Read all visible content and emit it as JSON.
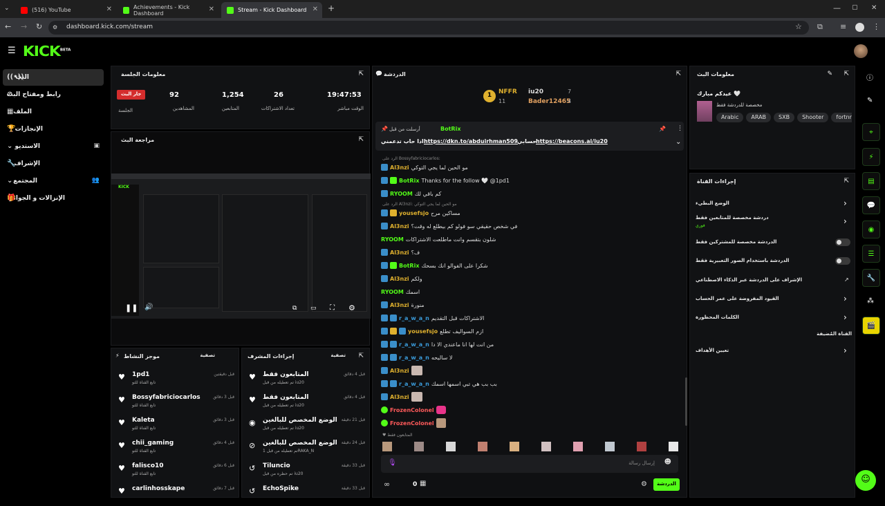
{
  "browser": {
    "tabs": [
      {
        "title": "(516) YouTube",
        "fav": "#ff0000"
      },
      {
        "title": "Achievements - Kick Dashboard",
        "fav": "#53fc18"
      },
      {
        "title": "Stream - Kick Dashboard",
        "fav": "#53fc18"
      }
    ],
    "url": "dashboard.kick.com/stream"
  },
  "brand": {
    "logo": "KICK",
    "beta": "BETA",
    "accent": "#53fc18"
  },
  "sidebar": {
    "items": [
      {
        "label": "البث",
        "icon": "broadcast-icon"
      },
      {
        "label": "رابط ومفتاح البث",
        "icon": "link-icon"
      },
      {
        "label": "الملف",
        "icon": "profile-icon"
      },
      {
        "label": "الإنجازات",
        "icon": "trophy-icon"
      },
      {
        "label": "الاستديو",
        "icon": "studio-icon"
      },
      {
        "label": "الإشراف",
        "icon": "wrench-icon"
      },
      {
        "label": "المجتمع",
        "icon": "community-icon"
      },
      {
        "label": "الإنزالات و الجوائز",
        "icon": "gift-icon"
      }
    ]
  },
  "session": {
    "title": "معلومات الجلسة",
    "live_badge": "جار البث",
    "session_label": "الجلسة",
    "stats": [
      {
        "value": "92",
        "label": "المشاهدين"
      },
      {
        "value": "1,254",
        "label": "المتابعين"
      },
      {
        "value": "26",
        "label": "تعداد الاشتراكات"
      },
      {
        "value": "19:47:53",
        "label": "الوقت مباشر"
      }
    ]
  },
  "preview": {
    "title": "مراجعة البث"
  },
  "activity": {
    "title": "موجز النشاط",
    "filter": "تصفية",
    "items": [
      {
        "name": "1pd1",
        "sub": "تابع القناة للتو",
        "time": "قبل دقيقتين"
      },
      {
        "name": "Bossyfabriciocarlos",
        "sub": "تابع القناة للتو",
        "time": "قبل 3 دقائق"
      },
      {
        "name": "Kaleta",
        "sub": "تابع القناة للتو",
        "time": "قبل 3 دقائق"
      },
      {
        "name": "chii_gaming",
        "sub": "تابع القناة للتو",
        "time": "قبل 4 دقائق"
      },
      {
        "name": "falisco10",
        "sub": "تابع القناة للتو",
        "time": "قبل 6 دقائق"
      },
      {
        "name": "carlinhosskape",
        "sub": "",
        "time": "قبل 7 دقائق"
      }
    ]
  },
  "modactions": {
    "title": "إجراءات المشرف",
    "filter": "تصفية",
    "items": [
      {
        "name": "المتابعون فقط",
        "sub": "تم تعطيله من قبل iu20",
        "time": "قبل 4 دقائق",
        "icon": "heart-icon"
      },
      {
        "name": "المتابعون فقط",
        "sub": "تم تعطيله من قبل iu20",
        "time": "قبل 4 دقائق",
        "icon": "heart-icon"
      },
      {
        "name": "الوضع المخصص للبالغين",
        "sub": "تم تعطيله من قبل iu20",
        "time": "قبل 21 دقيقة",
        "icon": "eye-icon"
      },
      {
        "name": "الوضع المخصص للبالغين",
        "sub": "تم تعطيله من قبل 1RAKA_N",
        "time": "قبل 24 دقيقة",
        "icon": "eye-off-icon"
      },
      {
        "name": "Tiluncio",
        "sub": "تم حظره من قبل iu20",
        "time": "قبل 33 دقيقة",
        "icon": "undo-icon"
      },
      {
        "name": "EchoSpike",
        "sub": "",
        "time": "قبل 33 دقيقة",
        "icon": "undo-icon"
      }
    ]
  },
  "chat": {
    "title": "الدردشة",
    "top": {
      "user1": "NFFR",
      "n1": "11",
      "user2": "iu20",
      "n2": "7",
      "user3": "Bader12465",
      "n3": "4"
    },
    "pinned": {
      "label": "أرسلت من قبل",
      "user": "BotRix",
      "text_a": "https://dkn.to/abduirhman509",
      "text_b": "حسابي",
      "text_c": "https://beacons.ai/iu20",
      "text_d": "اذا حاب تدعمني"
    },
    "messages": [
      {
        "reply": "الرد على Bossyfabriciocarlos:"
      },
      {
        "user": "Al3nzi",
        "color": "#e0b12e",
        "text": "مو الحين لما يجي التوكي"
      },
      {
        "user": "BotRix",
        "color": "#53fc18",
        "text": "Thanks for the follow 🤍 @1pd1"
      },
      {
        "user": "RYOOM",
        "color": "#53fc18",
        "text": "كم باقي لك"
      },
      {
        "reply": "الرد على Al3nzi: مو الحين لما يجي التوكي"
      },
      {
        "user": "yousefsjo",
        "color": "#e0b12e",
        "text": "مساكين مرح"
      },
      {
        "user": "Al3nzi",
        "color": "#e0b12e",
        "text": "في شخص حقيقي سو فولو كم بيطلع له وقت؟"
      },
      {
        "user": "RYOOM",
        "color": "#53fc18",
        "text": "شلون بتقسم وانت ماطلعت الاشتراكات"
      },
      {
        "user": "Al3nzi",
        "color": "#e0b12e",
        "text": "ف؟"
      },
      {
        "user": "BotRix",
        "color": "#53fc18",
        "text": "شكرا على الفوالو انك بسحك"
      },
      {
        "user": "Al3nzi",
        "color": "#e0b12e",
        "text": "ولكم"
      },
      {
        "user": "RYOOM",
        "color": "#53fc18",
        "text": "اسمك"
      },
      {
        "user": "Al3nzi",
        "color": "#e0b12e",
        "text": "منورة"
      },
      {
        "user": "r_a_w_a_n",
        "color": "#3a9ad9",
        "text": "الاشتراكات قبل التقديم"
      },
      {
        "user": "yousefsjo",
        "color": "#e0b12e",
        "text": "ازم السواليف تطلع"
      },
      {
        "user": "r_a_w_a_n",
        "color": "#3a9ad9",
        "text": "من انت لها انا ماعندي الا دا"
      },
      {
        "user": "r_a_w_a_n",
        "color": "#3a9ad9",
        "text": "لا ساليحه"
      },
      {
        "user": "Al3nzi",
        "color": "#e0b12e",
        "text": ""
      },
      {
        "user": "r_a_w_a_n",
        "color": "#3a9ad9",
        "text": "بب بب هي تبي اسمها اسمك"
      },
      {
        "user": "Al3nzi",
        "color": "#e0b12e",
        "text": ""
      },
      {
        "user": "FrozenColonel",
        "color": "#53fc18",
        "text": ""
      },
      {
        "user": "FrozenColonel",
        "color": "#53fc18",
        "text": ""
      }
    ],
    "followers_only": "المتابعون فقط",
    "input_placeholder": "إرسال رسالة",
    "send_label": "الدردشة",
    "points": "0"
  },
  "stream_info": {
    "title": "معلومات البث",
    "stream_title": "عيدكم مبارك 🤍",
    "category": "مخصصة للدردشة فقط",
    "tags": [
      "Arabic",
      "ARAB",
      "SXB",
      "Shooter",
      "fortnr"
    ]
  },
  "channel_actions": {
    "title": "إجراءات القناة",
    "items": [
      {
        "label": "الوضع البطيء",
        "control": "chevron"
      },
      {
        "label": "دردشة مخصصة للمتابعين فقط",
        "sub": "فوري",
        "control": "chevron"
      },
      {
        "label": "الدردشة مخصصة للمشتركين فقط",
        "control": "toggle"
      },
      {
        "label": "الدردشة باستخدام الصور التعبيرية فقط",
        "control": "toggle"
      },
      {
        "label": "الإشراف على الدردشة عبر الذكاء الاصطناعي",
        "control": "external"
      },
      {
        "label": "القيود المفروضة على عمر الحساب",
        "control": "chevron"
      },
      {
        "label": "الكلمات المحظورة",
        "control": "chevron"
      },
      {
        "label": "القناة المُضيفة",
        "control": "none"
      },
      {
        "label": "تعيين الأهداف",
        "control": "chevron"
      }
    ]
  }
}
